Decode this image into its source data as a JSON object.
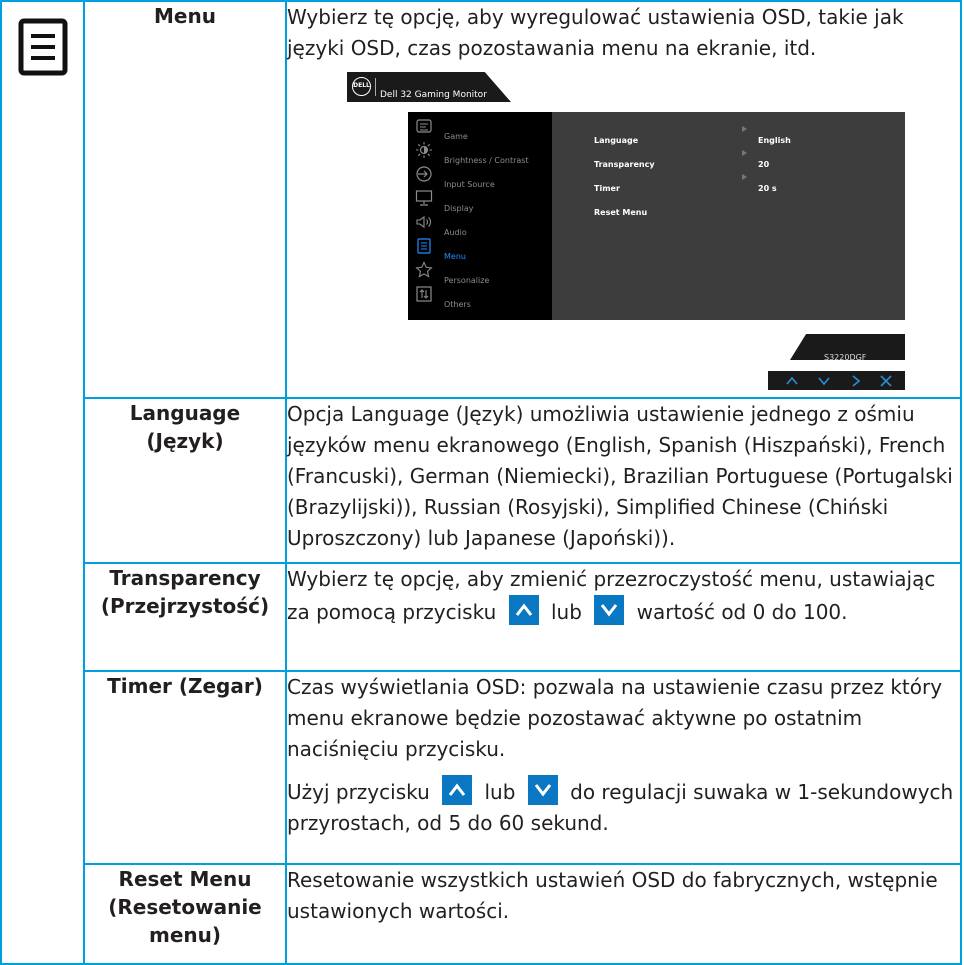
{
  "rows": {
    "menu": {
      "name": "Menu",
      "description": "Wybierz tę opcję, aby wyregulować ustawienia OSD, takie jak języki OSD, czas pozostawania menu na ekranie, itd."
    },
    "language": {
      "name_line1": "Language",
      "name_line2": "(Język)",
      "description": "Opcja Language (Język) umożliwia ustawienie jednego z ośmiu języków menu ekranowego (English, Spanish (Hiszpański), French (Francuski), German (Niemiecki), Brazilian Portuguese (Portugalski (Brazylijski)), Russian (Rosyjski), Simplified Chinese (Chiński Uproszczony) lub Japanese (Japoński))."
    },
    "transparency": {
      "name_line1": "Transparency",
      "name_line2": "(Przejrzystość)",
      "description_part1": "Wybierz tę opcję, aby zmienić przezroczystość menu, ustawiając za pomocą przycisku",
      "description_part2": "lub",
      "description_part3": "wartość od 0 do 100."
    },
    "timer": {
      "name": "Timer (Zegar)",
      "description1": "Czas wyświetlania OSD: pozwala na ustawienie czasu przez który menu ekranowe będzie pozostawać aktywne po ostatnim naciśnięciu przycisku.",
      "description2_part1": "Użyj przycisku",
      "description2_part2": "lub",
      "description2_part3": "do regulacji suwaka w 1-sekundowych przyrostach, od 5 do 60 sekund."
    },
    "reset": {
      "name_line1": "Reset Menu",
      "name_line2": "(Resetowanie",
      "name_line3": "menu)",
      "description": "Resetowanie wszystkich ustawień OSD do fabrycznych, wstępnie ustawionych wartości."
    }
  },
  "osd": {
    "logo_text": "DELL",
    "title": "Dell 32 Gaming Monitor",
    "menu_items": [
      {
        "label": "Game",
        "icon": "game-icon"
      },
      {
        "label": "Brightness / Contrast",
        "icon": "brightness-icon"
      },
      {
        "label": "Input Source",
        "icon": "input-source-icon"
      },
      {
        "label": "Display",
        "icon": "display-icon"
      },
      {
        "label": "Audio",
        "icon": "audio-icon"
      },
      {
        "label": "Menu",
        "icon": "menu-icon",
        "active": true
      },
      {
        "label": "Personalize",
        "icon": "star-icon"
      },
      {
        "label": "Others",
        "icon": "others-icon"
      }
    ],
    "settings": [
      {
        "label": "Language",
        "value": "English"
      },
      {
        "label": "Transparency",
        "value": "20"
      },
      {
        "label": "Timer",
        "value": "20 s"
      },
      {
        "label": "Reset Menu",
        "value": ""
      }
    ],
    "model": "S3220DGF",
    "nav_buttons": [
      "up",
      "down",
      "right",
      "close"
    ]
  },
  "colors": {
    "border": "#009fdf",
    "button_blue": "#0a77c2",
    "osd_active": "#1e90ff",
    "nav_arrow": "#2a8fd6"
  }
}
